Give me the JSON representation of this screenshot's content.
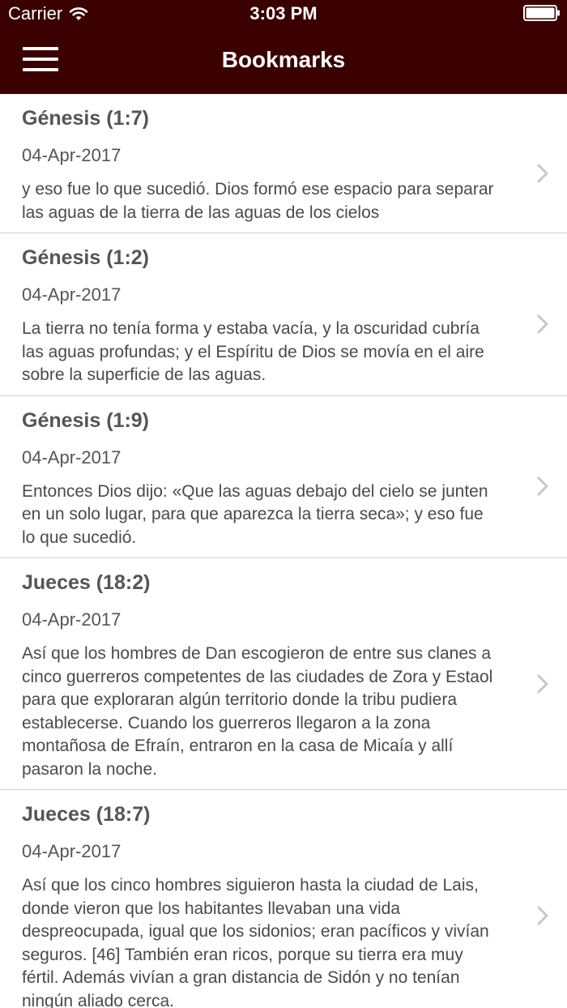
{
  "status_bar": {
    "carrier": "Carrier",
    "time": "3:03 PM"
  },
  "nav": {
    "title": "Bookmarks"
  },
  "bookmarks": [
    {
      "title": "Génesis (1:7)",
      "date": "04-Apr-2017",
      "text": "y eso fue lo que sucedió. Dios formó ese espacio para separar las aguas de la tierra de las aguas de los cielos"
    },
    {
      "title": "Génesis (1:2)",
      "date": "04-Apr-2017",
      "text": "La tierra no tenía forma y estaba vacía, y la oscuridad cubría las aguas profundas; y el Espíritu de Dios se movía en el aire sobre la superficie de las aguas."
    },
    {
      "title": "Génesis (1:9)",
      "date": "04-Apr-2017",
      "text": "Entonces Dios dijo: «Que las aguas debajo del cielo se junten en un solo lugar, para que aparezca la tierra seca»; y eso fue lo que sucedió."
    },
    {
      "title": "Jueces (18:2)",
      "date": "04-Apr-2017",
      "text": "Así que los hombres de Dan escogieron de entre sus clanes a cinco guerreros competentes de las ciudades de Zora y Estaol para que exploraran algún territorio donde la tribu pudiera establecerse. Cuando los guerreros llegaron a la zona montañosa de Efraín, entraron en la casa de Micaía y allí pasaron la noche."
    },
    {
      "title": "Jueces (18:7)",
      "date": "04-Apr-2017",
      "text": "Así que los cinco hombres siguieron hasta la ciudad de Lais, donde vieron que los habitantes llevaban una vida despreocupada, igual que los sidonios; eran pacíficos y vivían seguros. [46] También eran ricos, porque su tierra era muy fértil. Además vivían a gran distancia de Sidón y no tenían ningún aliado cerca."
    }
  ],
  "colors": {
    "header_bg": "#3b0000",
    "header_text": "#ffffff",
    "divider": "#cfcfcf",
    "chevron": "#c7c7cc"
  },
  "icons": {
    "menu": "menu-icon",
    "wifi": "wifi-icon",
    "battery": "battery-icon",
    "chevron": "chevron-right-icon"
  }
}
